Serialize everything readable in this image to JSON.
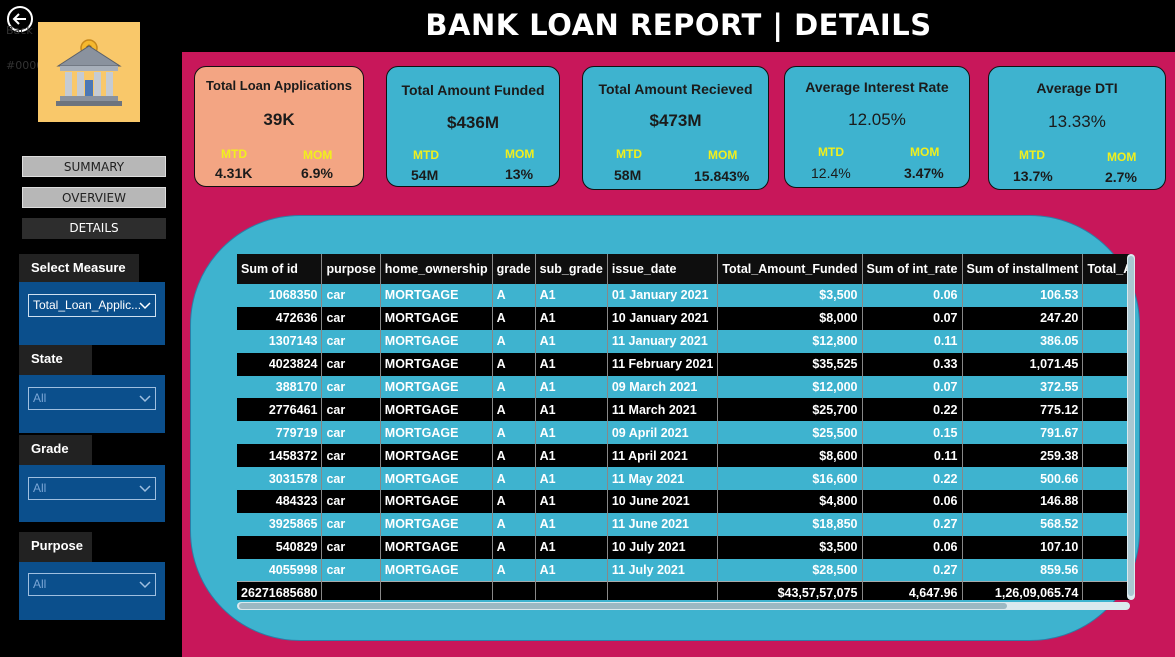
{
  "header": {
    "title": "BANK LOAN REPORT | DETAILS",
    "back_hint": "Back",
    "color_hint": "#0000"
  },
  "nav": {
    "summary": "SUMMARY",
    "overview": "OVERVIEW",
    "details": "DETAILS"
  },
  "filters": {
    "measure": {
      "label": "Select Measure",
      "value": "Total_Loan_Applic..."
    },
    "state": {
      "label": "State",
      "value": "All"
    },
    "grade": {
      "label": "Grade",
      "value": "All"
    },
    "purpose": {
      "label": "Purpose",
      "value": "All"
    }
  },
  "kpis": [
    {
      "title": "Total Loan Applications",
      "value": "39K",
      "mtd_label": "MTD",
      "mtd": "4.31K",
      "mom_label": "MOM",
      "mom": "6.9%",
      "color": "#f3a583"
    },
    {
      "title": "Total Amount Funded",
      "value": "$436M",
      "mtd_label": "MTD",
      "mtd": "54M",
      "mom_label": "MOM",
      "mom": "13%",
      "color": "#3eb3cf"
    },
    {
      "title": "Total Amount Recieved",
      "value": "$473M",
      "mtd_label": "MTD",
      "mtd": "58M",
      "mom_label": "MOM",
      "mom": "15.843%",
      "color": "#3eb3cf"
    },
    {
      "title": "Average Interest Rate",
      "value": "12.05%",
      "mtd_label": "MTD",
      "mtd": "12.4%",
      "mom_label": "MOM",
      "mom": "3.47%",
      "color": "#3eb3cf"
    },
    {
      "title": "Average DTI",
      "value": "13.33%",
      "mtd_label": "MTD",
      "mtd": "13.7%",
      "mom_label": "MOM",
      "mom": "2.7%",
      "color": "#3eb3cf"
    }
  ],
  "table": {
    "columns": [
      "Sum of id",
      "purpose",
      "home_ownership",
      "grade",
      "sub_grade",
      "issue_date",
      "Total_Amount_Funded",
      "Sum of int_rate",
      "Sum of installment",
      "Total_A"
    ],
    "rows": [
      [
        "1068350",
        "car",
        "MORTGAGE",
        "A",
        "A1",
        "01 January 2021",
        "$3,500",
        "0.06",
        "106.53",
        ""
      ],
      [
        "472636",
        "car",
        "MORTGAGE",
        "A",
        "A1",
        "10 January 2021",
        "$8,000",
        "0.07",
        "247.20",
        ""
      ],
      [
        "1307143",
        "car",
        "MORTGAGE",
        "A",
        "A1",
        "11 January 2021",
        "$12,800",
        "0.11",
        "386.05",
        ""
      ],
      [
        "4023824",
        "car",
        "MORTGAGE",
        "A",
        "A1",
        "11 February 2021",
        "$35,525",
        "0.33",
        "1,071.45",
        ""
      ],
      [
        "388170",
        "car",
        "MORTGAGE",
        "A",
        "A1",
        "09 March 2021",
        "$12,000",
        "0.07",
        "372.55",
        ""
      ],
      [
        "2776461",
        "car",
        "MORTGAGE",
        "A",
        "A1",
        "11 March 2021",
        "$25,700",
        "0.22",
        "775.12",
        ""
      ],
      [
        "779719",
        "car",
        "MORTGAGE",
        "A",
        "A1",
        "09 April 2021",
        "$25,500",
        "0.15",
        "791.67",
        ""
      ],
      [
        "1458372",
        "car",
        "MORTGAGE",
        "A",
        "A1",
        "11 April 2021",
        "$8,600",
        "0.11",
        "259.38",
        ""
      ],
      [
        "3031578",
        "car",
        "MORTGAGE",
        "A",
        "A1",
        "11 May 2021",
        "$16,600",
        "0.22",
        "500.66",
        ""
      ],
      [
        "484323",
        "car",
        "MORTGAGE",
        "A",
        "A1",
        "10 June 2021",
        "$4,800",
        "0.06",
        "146.88",
        ""
      ],
      [
        "3925865",
        "car",
        "MORTGAGE",
        "A",
        "A1",
        "11 June 2021",
        "$18,850",
        "0.27",
        "568.52",
        ""
      ],
      [
        "540829",
        "car",
        "MORTGAGE",
        "A",
        "A1",
        "10 July 2021",
        "$3,500",
        "0.06",
        "107.10",
        ""
      ],
      [
        "4055998",
        "car",
        "MORTGAGE",
        "A",
        "A1",
        "11 July 2021",
        "$28,500",
        "0.27",
        "859.56",
        ""
      ]
    ],
    "total": [
      "26271685680",
      "",
      "",
      "",
      "",
      "",
      "$43,57,57,075",
      "4,647.96",
      "1,26,09,065.74",
      ""
    ]
  },
  "colors": {
    "background": "#c8175a",
    "card_blue": "#3eb3cf",
    "card_orange": "#f3a583",
    "accent_yellow": "#f1ef1d",
    "filter_blue": "#0b4f8c"
  }
}
